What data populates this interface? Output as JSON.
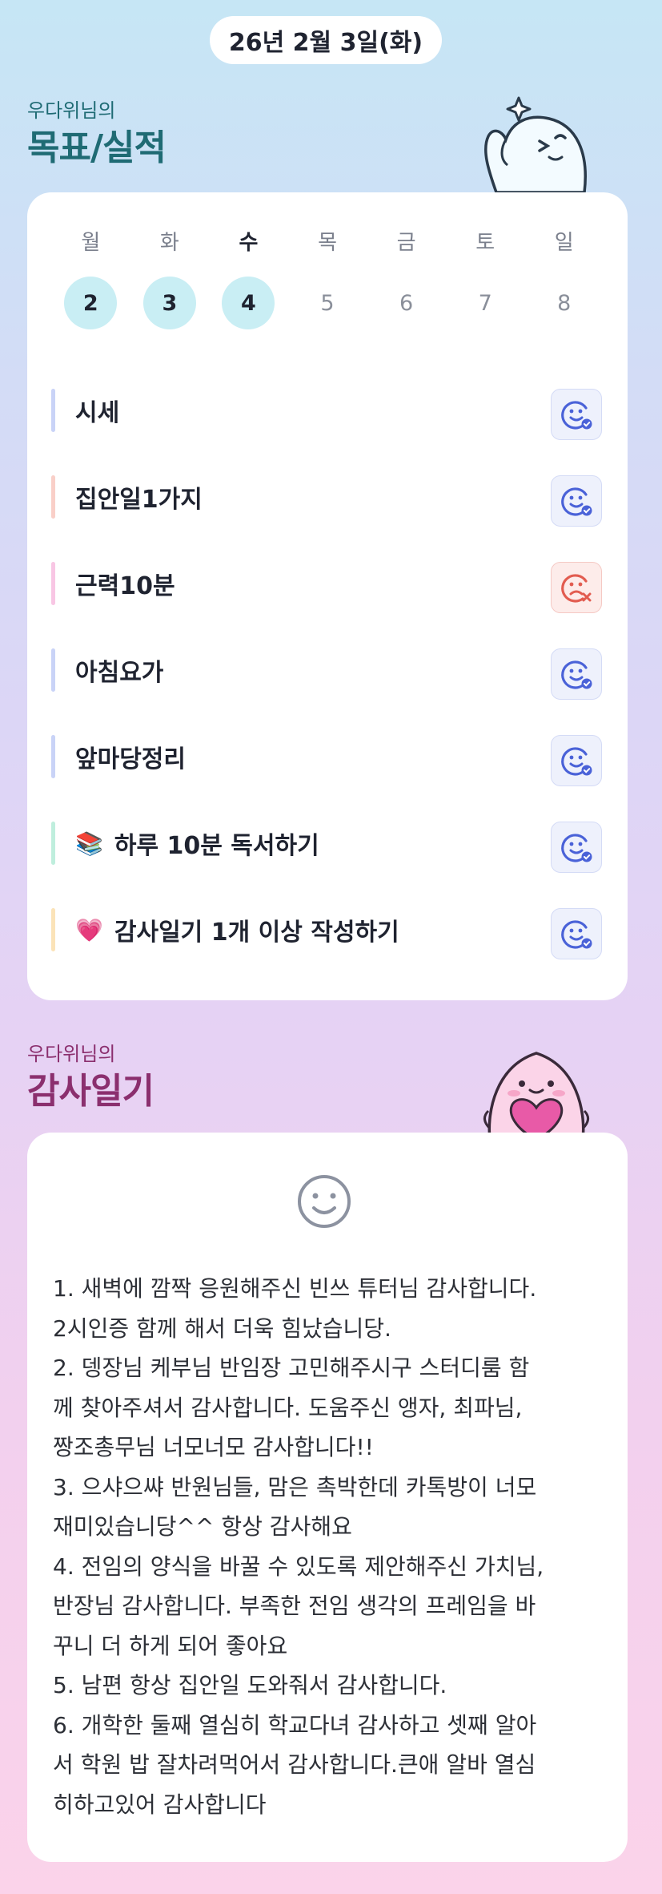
{
  "header": {
    "date": "26년 2월 3일(화)"
  },
  "goals_section": {
    "subtitle": "우다위님의",
    "title": "목표/실적"
  },
  "calendar": {
    "weekdays": [
      "월",
      "화",
      "수",
      "목",
      "금",
      "토",
      "일"
    ],
    "days": [
      "2",
      "3",
      "4",
      "5",
      "6",
      "7",
      "8"
    ],
    "today_index": 2,
    "completed_indexes": [
      0,
      1,
      2
    ]
  },
  "tasks": [
    {
      "label": "시세",
      "bar_color": "#c9d3f7",
      "status": "success",
      "status_icon": "smile-check-icon"
    },
    {
      "label": "집안일1가지",
      "bar_color": "#f9cfc8",
      "status": "success",
      "status_icon": "smile-check-icon"
    },
    {
      "label": "근력10분",
      "bar_color": "#f8c6e4",
      "status": "fail",
      "status_icon": "frown-x-icon"
    },
    {
      "label": "아침요가",
      "bar_color": "#c9d3f7",
      "status": "success",
      "status_icon": "smile-check-icon"
    },
    {
      "label": "앞마당정리",
      "bar_color": "#c9d3f7",
      "status": "success",
      "status_icon": "smile-check-icon"
    },
    {
      "label": "하루 10분 독서하기",
      "emoji": "📚",
      "bar_color": "#bfeedd",
      "status": "success",
      "status_icon": "smile-check-icon"
    },
    {
      "label": "감사일기 1개 이상 작성하기",
      "emoji": "💗",
      "bar_color": "#fbe3b8",
      "status": "success",
      "status_icon": "smile-check-icon"
    }
  ],
  "diary_section": {
    "subtitle": "우다위님의",
    "title": "감사일기"
  },
  "diary": {
    "mood_icon": "smile-face-icon",
    "lines": [
      "1. 새벽에 깜짝 응원해주신 빈쓰 튜터님 감사합니다.",
      "2시인증 함께 해서 더욱 힘났습니당.",
      "2. 뎅장님 케부님 반임장 고민해주시구 스터디룸 함",
      "께 찾아주셔서 감사합니다. 도움주신 앵자, 최파님,",
      "짱조총무님 너모너모 감사합니다!!",
      "3. 으샤으쌰 반원님들, 맘은 촉박한데 카톡방이 너모",
      "재미있습니당^^ 항상 감사해요",
      "4. 전임의 양식을 바꿀 수 있도록 제안해주신 가치님,",
      "반장님 감사합니다. 부족한 전임 생각의 프레임을 바",
      "꾸니 더 하게 되어 좋아요",
      "5. 남편 항상 집안일 도와줘서 감사합니다.",
      "6. 개학한 둘째 열심히 학교다녀 감사하고 셋째 알아",
      "서 학원 밥 잘차려먹어서 감사합니다.큰애 알바 열심",
      "히하고있어 감사합니다"
    ]
  },
  "colors": {
    "goal_title": "#1f6b74",
    "diary_title": "#8b2f6e",
    "accent_blue": "#4a62d8",
    "fail_red": "#e25c50"
  }
}
